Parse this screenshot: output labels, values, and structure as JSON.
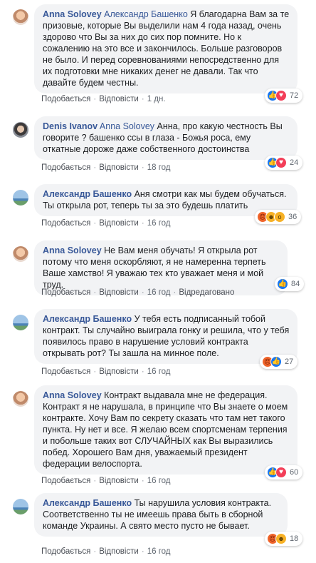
{
  "meta_labels": {
    "like": "Подобається",
    "reply": "Відповісти",
    "edited": "Відредаговано"
  },
  "comments": [
    {
      "author": "Anna Solovey",
      "mention": "Александр Башенко",
      "text": "Я благодарна Вам за те призовые, которые Вы выделили нам 4 года назад, очень здорово что Вы за них до сих пор помните. Но к сожалению на это все и закончилось. Больше разговоров не было. И перед соревнованиями непосредственно для их подготовки мне никаких денег не давали. Так что давайте будем честны.",
      "time": "1 дн.",
      "reactions": [
        "like-icon",
        "love-icon"
      ],
      "count": "72",
      "edited": false
    },
    {
      "author": "Denis Ivanov",
      "mention": "Anna Solovey",
      "text": "Анна, про какую честность Вы говорите ? башенко ссы в глаза - Божья роса, ему откатные дороже даже собственного достоинства",
      "time": "18 год",
      "reactions": [
        "like-icon",
        "love-icon"
      ],
      "count": "24",
      "edited": false
    },
    {
      "author": "Александр Башенко",
      "mention": "",
      "text": "Аня смотри как мы будем обучаться. Ты открыла рот, теперь ты за это будешь платить",
      "time": "16 год",
      "reactions": [
        "angry-icon",
        "haha-icon",
        "wow-icon"
      ],
      "count": "36",
      "edited": false
    },
    {
      "author": "Anna Solovey",
      "mention": "",
      "text": "Не Вам меня обучать! Я открыла рот потому что меня оскорбляют, я не намеренна терпеть Ваше хамство! Я уважаю тех кто уважает меня и мой труд.",
      "time": "16 год",
      "reactions": [
        "like-icon"
      ],
      "count": "84",
      "edited": true
    },
    {
      "author": "Александр Башенко",
      "mention": "",
      "text": "У тебя есть подписанный тобой контракт. Ты случайно выиграла гонку и решила, что у тебя появилось право в нарушение условий контракта открывать рот? Ты зашла на минное поле.",
      "time": "16 год",
      "reactions": [
        "angry-icon",
        "like-icon"
      ],
      "count": "27",
      "edited": false
    },
    {
      "author": "Anna Solovey",
      "mention": "",
      "text": "Контракт выдавала мне не федерация. Контракт я не нарушала, в принципе что Вы знаете о моем контракте. Хочу Вам по секрету сказать что там нет такого пункта. Ну нет и все. Я желаю всем спортсменам терпения и побольше таких вот СЛУЧАЙНЫХ как Вы выразились побед. Хорошего Вам дня, уважаемый президент федерации велоспорта.",
      "time": "16 год",
      "reactions": [
        "like-icon",
        "love-icon"
      ],
      "count": "60",
      "edited": false
    },
    {
      "author": "Александр Башенко",
      "mention": "",
      "text": "Ты нарушила условия контракта. Соответственно ты не имеешь права быть в сборной команде Украины. А свято место пусто не бывает.",
      "time": "16 год",
      "reactions": [
        "angry-icon",
        "haha-icon"
      ],
      "count": "18",
      "edited": false
    }
  ]
}
